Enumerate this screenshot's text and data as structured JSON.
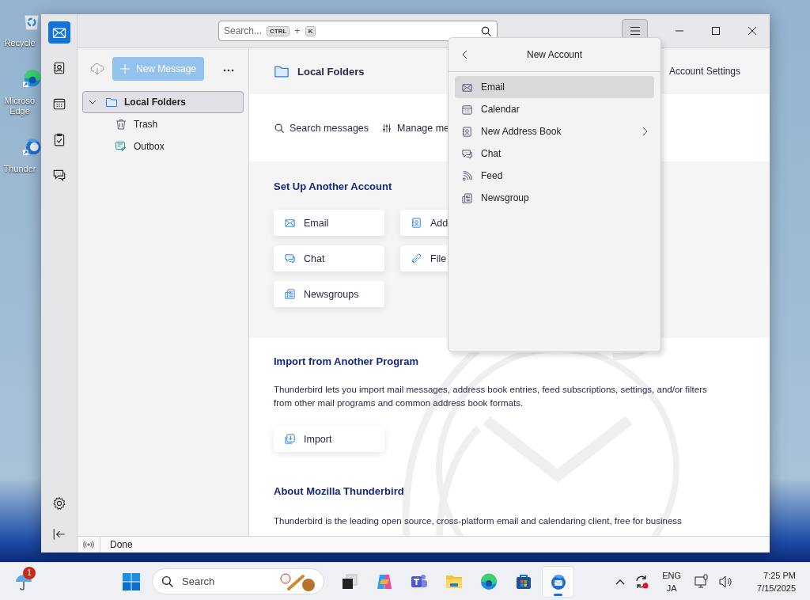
{
  "desktop": {
    "icons": [
      {
        "kind": "recycle",
        "label_lines": [
          "Recycle"
        ]
      },
      {
        "kind": "edge",
        "label_lines": [
          "Microso",
          "Edge"
        ]
      },
      {
        "kind": "thunderbird",
        "label_lines": [
          "Thunder"
        ]
      }
    ]
  },
  "window": {
    "spaces": [
      {
        "kind": "mail",
        "selected": true
      },
      {
        "kind": "addressbook",
        "selected": false
      },
      {
        "kind": "calendar",
        "selected": false
      },
      {
        "kind": "tasks",
        "selected": false
      },
      {
        "kind": "chat",
        "selected": false
      }
    ],
    "search": {
      "placeholder": "Search...",
      "shortcut_keys": [
        "CTRL",
        "K"
      ],
      "shortcut_joiner": "+"
    },
    "menu_button": {
      "pressed": true
    },
    "folder_pane": {
      "new_message": {
        "label": "New Message",
        "disabled": true
      },
      "folders": [
        {
          "name": "Local Folders",
          "kind": "account",
          "selected": true,
          "expanded": true,
          "children": [
            {
              "name": "Trash",
              "kind": "trash",
              "selected": false
            },
            {
              "name": "Outbox",
              "kind": "outbox",
              "selected": false
            }
          ]
        }
      ]
    },
    "account_hub": {
      "title": "Local Folders",
      "account_settings": "Account Settings",
      "actions": [
        {
          "label": "Search messages",
          "kind": "search"
        },
        {
          "label": "Manage me",
          "kind": "filters"
        }
      ],
      "setup": {
        "heading": "Set Up Another Account",
        "buttons": [
          {
            "label": "Email",
            "kind": "email"
          },
          {
            "label": "Add",
            "kind": "addressbook"
          },
          {
            "label": "Chat",
            "kind": "chat"
          },
          {
            "label": "File",
            "kind": "link"
          },
          {
            "label": "Newsgroups",
            "kind": "news"
          }
        ]
      },
      "import": {
        "heading": "Import from Another Program",
        "text": "Thunderbird lets you import mail messages, address book entries, feed subscriptions, settings, and/or filters from other mail programs and common address book formats.",
        "button": "Import"
      },
      "about": {
        "heading": "About Mozilla Thunderbird",
        "text": "Thunderbird is the leading open source, cross-platform email and calendaring client, free for business"
      }
    },
    "status_bar": {
      "text": "Done"
    },
    "menu": {
      "title": "New Account",
      "items": [
        {
          "label": "Email",
          "kind": "email",
          "selected": true,
          "submenu": false
        },
        {
          "label": "Calendar",
          "kind": "calendar",
          "selected": false,
          "submenu": false
        },
        {
          "label": "New Address Book",
          "kind": "addressbook",
          "selected": false,
          "submenu": true
        },
        {
          "label": "Chat",
          "kind": "chat",
          "selected": false,
          "submenu": false
        },
        {
          "label": "Feed",
          "kind": "feed",
          "selected": false,
          "submenu": false
        },
        {
          "label": "Newsgroup",
          "kind": "news",
          "selected": false,
          "submenu": false
        }
      ]
    }
  },
  "taskbar": {
    "weather_badge": "1",
    "search_placeholder": "Search",
    "apps": [
      {
        "kind": "taskview",
        "selected": false
      },
      {
        "kind": "copilot",
        "selected": false
      },
      {
        "kind": "teams",
        "selected": false
      },
      {
        "kind": "explorer",
        "selected": false
      },
      {
        "kind": "edge",
        "selected": false
      },
      {
        "kind": "store",
        "selected": false
      },
      {
        "kind": "thunderbird",
        "selected": true
      }
    ],
    "language": [
      "ENG",
      "JA"
    ],
    "time": "7:25 PM",
    "date": "7/15/2025"
  }
}
